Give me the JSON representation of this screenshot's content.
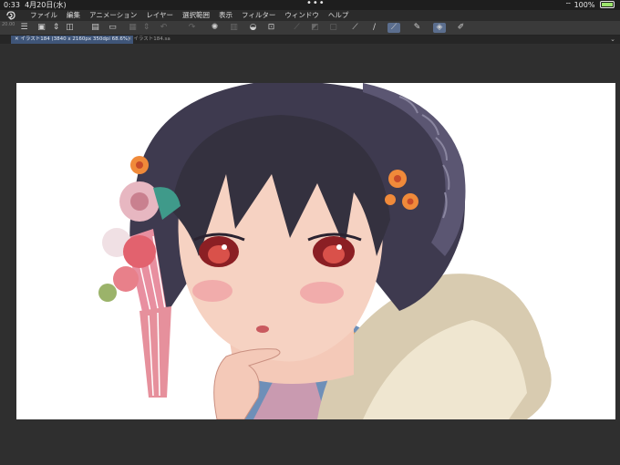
{
  "status": {
    "time": "0:33",
    "date": "4月20日(水)",
    "dots": "•••",
    "battery": "100%"
  },
  "menu": {
    "items": [
      "ファイル",
      "編集",
      "アニメーション",
      "レイヤー",
      "選択範囲",
      "表示",
      "フィルター",
      "ウィンドウ",
      "ヘルプ"
    ]
  },
  "toolbar": {
    "icons": [
      "hamburger-icon",
      "new-file-icon",
      "stepper-icon",
      "gallery-icon",
      "new-canvas-icon",
      "open-folder-icon",
      "save-icon",
      "stepper2-icon",
      "undo-icon",
      "redo-icon",
      "loading-icon",
      "clear-icon",
      "fill-icon",
      "crop-icon",
      "transform-icon",
      "deselect-icon",
      "invert-icon",
      "pen-icon",
      "brush-icon",
      "selected-tool-icon",
      "pen-tool-icon",
      "eraser-icon",
      "edit-icon"
    ]
  },
  "tabs": {
    "active": "イラスト184 (3840 x 2160px 350dpi 68.6%)",
    "inactive": "イラスト184.sa",
    "zoom_label": "20.00"
  },
  "colors": {
    "accent": "#5b6e8e",
    "tab_active": "#3f5578",
    "bg": "#2f2f2f"
  }
}
